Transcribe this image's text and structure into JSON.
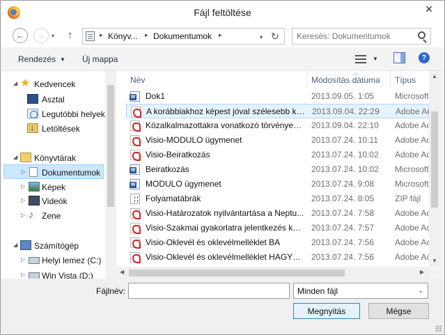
{
  "window": {
    "title": "Fájl feltöltése",
    "close_label": "✕"
  },
  "nav": {
    "back_glyph": "←",
    "forward_glyph": "→",
    "recent_glyph": "▾",
    "up_glyph": "↑",
    "breadcrumbs": [
      "Könyv...",
      "Dokumentumok"
    ],
    "separator_glyph": "▸",
    "refresh_glyph": "↻",
    "search_placeholder": "Keresés: Dokumentumok"
  },
  "toolbar": {
    "organize_label": "Rendezés",
    "new_folder_label": "Új mappa",
    "caret_glyph": "▼",
    "help_glyph": "?"
  },
  "sidebar": {
    "favorites": {
      "label": "Kedvencek",
      "items": [
        "Asztal",
        "Legutóbbi helyek",
        "Letöltések"
      ]
    },
    "libraries": {
      "label": "Könyvtárak",
      "items": [
        "Dokumentumok",
        "Képek",
        "Videók",
        "Zene"
      ],
      "selected": "Dokumentumok"
    },
    "computer": {
      "label": "Számítógép",
      "items": [
        "Helyi lemez (C:)",
        "Win Vista (D:)"
      ]
    },
    "expanded_glyph": "◢",
    "collapsed_glyph": "▷"
  },
  "columns": {
    "name": "Név",
    "modified": "Módosítás dátuma",
    "type": "Típus",
    "sort_glyph": "︿"
  },
  "files": [
    {
      "name": "Dok1",
      "modified": "2013.09.05. 1:05",
      "type": "Microsoft",
      "icon": "word-icon"
    },
    {
      "name": "A korábbiakhoz képest jóval szélesebb kö...",
      "modified": "2013.09.04. 22:29",
      "type": "Adobe Ac",
      "icon": "pdf-icon"
    },
    {
      "name": "Közalkalmazottakra vonatkozó törvények...",
      "modified": "2013.09.04. 22:10",
      "type": "Adobe Ac",
      "icon": "pdf-icon"
    },
    {
      "name": "Visio-MODULO ügymenet",
      "modified": "2013.07.24. 10:11",
      "type": "Adobe Ac",
      "icon": "pdf-icon"
    },
    {
      "name": "Visio-Beiratkozás",
      "modified": "2013.07.24. 10:02",
      "type": "Adobe Ac",
      "icon": "pdf-icon"
    },
    {
      "name": "Beiratkozás",
      "modified": "2013.07.24. 10:02",
      "type": "Microsoft",
      "icon": "word-icon"
    },
    {
      "name": "MODULO ügymenet",
      "modified": "2013.07.24. 9:08",
      "type": "Microsoft",
      "icon": "word-icon"
    },
    {
      "name": "Folyamatábrák",
      "modified": "2013.07.24. 8:05",
      "type": "ZIP fájl",
      "icon": "zip-icon"
    },
    {
      "name": "Visio-Határozatok nyilvántartása a Neptu...",
      "modified": "2013.07.24. 7:58",
      "type": "Adobe Ac",
      "icon": "pdf-icon"
    },
    {
      "name": "Visio-Szakmai gyakorlatra jelentkezés kez...",
      "modified": "2013.07.24. 7:57",
      "type": "Adobe Ac",
      "icon": "pdf-icon"
    },
    {
      "name": "Visio-Oklevél és oklevélmelléklet BA",
      "modified": "2013.07.24. 7:56",
      "type": "Adobe Ac",
      "icon": "pdf-icon"
    },
    {
      "name": "Visio-Oklevél és oklevélmelléklet HAGYO...",
      "modified": "2013.07.24. 7:56",
      "type": "Adobe Ac",
      "icon": "pdf-icon"
    }
  ],
  "selected_file_index": 1,
  "scroll": {
    "up_glyph": "▲",
    "down_glyph": "▼",
    "left_glyph": "◀",
    "right_glyph": "▶"
  },
  "bottom": {
    "filename_label": "Fájlnév:",
    "filename_value": "",
    "filter_value": "Minden fájl",
    "filter_chevron": "⌄",
    "open_label": "Megnyitás",
    "cancel_label": "Mégse"
  }
}
